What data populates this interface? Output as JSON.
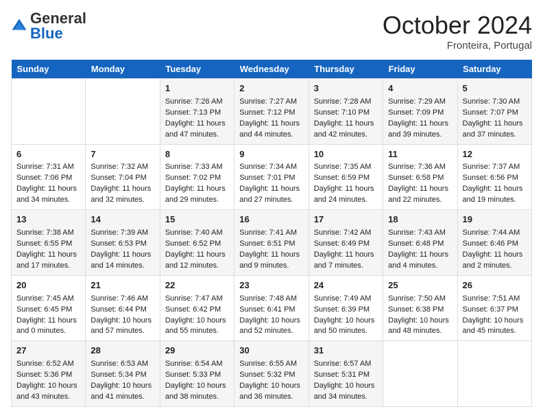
{
  "header": {
    "logo_general": "General",
    "logo_blue": "Blue",
    "month_title": "October 2024",
    "location": "Fronteira, Portugal"
  },
  "days_of_week": [
    "Sunday",
    "Monday",
    "Tuesday",
    "Wednesday",
    "Thursday",
    "Friday",
    "Saturday"
  ],
  "weeks": [
    [
      {
        "day": "",
        "info": ""
      },
      {
        "day": "",
        "info": ""
      },
      {
        "day": "1",
        "info": "Sunrise: 7:26 AM\nSunset: 7:13 PM\nDaylight: 11 hours and 47 minutes."
      },
      {
        "day": "2",
        "info": "Sunrise: 7:27 AM\nSunset: 7:12 PM\nDaylight: 11 hours and 44 minutes."
      },
      {
        "day": "3",
        "info": "Sunrise: 7:28 AM\nSunset: 7:10 PM\nDaylight: 11 hours and 42 minutes."
      },
      {
        "day": "4",
        "info": "Sunrise: 7:29 AM\nSunset: 7:09 PM\nDaylight: 11 hours and 39 minutes."
      },
      {
        "day": "5",
        "info": "Sunrise: 7:30 AM\nSunset: 7:07 PM\nDaylight: 11 hours and 37 minutes."
      }
    ],
    [
      {
        "day": "6",
        "info": "Sunrise: 7:31 AM\nSunset: 7:06 PM\nDaylight: 11 hours and 34 minutes."
      },
      {
        "day": "7",
        "info": "Sunrise: 7:32 AM\nSunset: 7:04 PM\nDaylight: 11 hours and 32 minutes."
      },
      {
        "day": "8",
        "info": "Sunrise: 7:33 AM\nSunset: 7:02 PM\nDaylight: 11 hours and 29 minutes."
      },
      {
        "day": "9",
        "info": "Sunrise: 7:34 AM\nSunset: 7:01 PM\nDaylight: 11 hours and 27 minutes."
      },
      {
        "day": "10",
        "info": "Sunrise: 7:35 AM\nSunset: 6:59 PM\nDaylight: 11 hours and 24 minutes."
      },
      {
        "day": "11",
        "info": "Sunrise: 7:36 AM\nSunset: 6:58 PM\nDaylight: 11 hours and 22 minutes."
      },
      {
        "day": "12",
        "info": "Sunrise: 7:37 AM\nSunset: 6:56 PM\nDaylight: 11 hours and 19 minutes."
      }
    ],
    [
      {
        "day": "13",
        "info": "Sunrise: 7:38 AM\nSunset: 6:55 PM\nDaylight: 11 hours and 17 minutes."
      },
      {
        "day": "14",
        "info": "Sunrise: 7:39 AM\nSunset: 6:53 PM\nDaylight: 11 hours and 14 minutes."
      },
      {
        "day": "15",
        "info": "Sunrise: 7:40 AM\nSunset: 6:52 PM\nDaylight: 11 hours and 12 minutes."
      },
      {
        "day": "16",
        "info": "Sunrise: 7:41 AM\nSunset: 6:51 PM\nDaylight: 11 hours and 9 minutes."
      },
      {
        "day": "17",
        "info": "Sunrise: 7:42 AM\nSunset: 6:49 PM\nDaylight: 11 hours and 7 minutes."
      },
      {
        "day": "18",
        "info": "Sunrise: 7:43 AM\nSunset: 6:48 PM\nDaylight: 11 hours and 4 minutes."
      },
      {
        "day": "19",
        "info": "Sunrise: 7:44 AM\nSunset: 6:46 PM\nDaylight: 11 hours and 2 minutes."
      }
    ],
    [
      {
        "day": "20",
        "info": "Sunrise: 7:45 AM\nSunset: 6:45 PM\nDaylight: 11 hours and 0 minutes."
      },
      {
        "day": "21",
        "info": "Sunrise: 7:46 AM\nSunset: 6:44 PM\nDaylight: 10 hours and 57 minutes."
      },
      {
        "day": "22",
        "info": "Sunrise: 7:47 AM\nSunset: 6:42 PM\nDaylight: 10 hours and 55 minutes."
      },
      {
        "day": "23",
        "info": "Sunrise: 7:48 AM\nSunset: 6:41 PM\nDaylight: 10 hours and 52 minutes."
      },
      {
        "day": "24",
        "info": "Sunrise: 7:49 AM\nSunset: 6:39 PM\nDaylight: 10 hours and 50 minutes."
      },
      {
        "day": "25",
        "info": "Sunrise: 7:50 AM\nSunset: 6:38 PM\nDaylight: 10 hours and 48 minutes."
      },
      {
        "day": "26",
        "info": "Sunrise: 7:51 AM\nSunset: 6:37 PM\nDaylight: 10 hours and 45 minutes."
      }
    ],
    [
      {
        "day": "27",
        "info": "Sunrise: 6:52 AM\nSunset: 5:36 PM\nDaylight: 10 hours and 43 minutes."
      },
      {
        "day": "28",
        "info": "Sunrise: 6:53 AM\nSunset: 5:34 PM\nDaylight: 10 hours and 41 minutes."
      },
      {
        "day": "29",
        "info": "Sunrise: 6:54 AM\nSunset: 5:33 PM\nDaylight: 10 hours and 38 minutes."
      },
      {
        "day": "30",
        "info": "Sunrise: 6:55 AM\nSunset: 5:32 PM\nDaylight: 10 hours and 36 minutes."
      },
      {
        "day": "31",
        "info": "Sunrise: 6:57 AM\nSunset: 5:31 PM\nDaylight: 10 hours and 34 minutes."
      },
      {
        "day": "",
        "info": ""
      },
      {
        "day": "",
        "info": ""
      }
    ]
  ]
}
